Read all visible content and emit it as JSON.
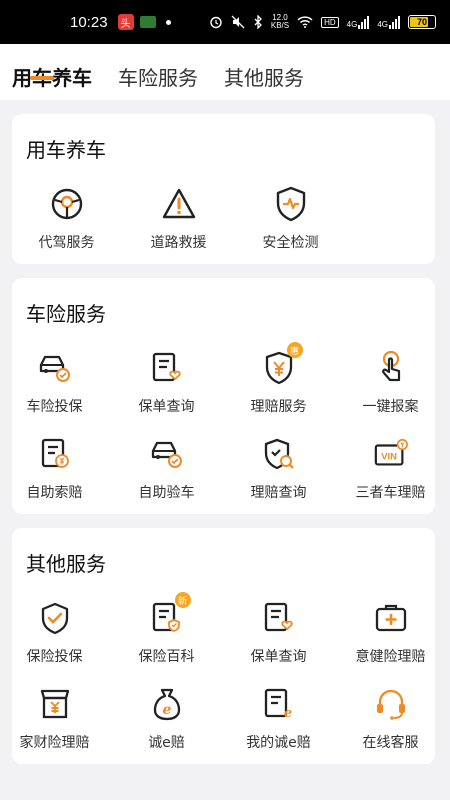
{
  "status_bar": {
    "time": "10:23",
    "app_badge": "头",
    "net_speed_value": "12.0",
    "net_speed_unit": "KB/S",
    "hd": "HD",
    "signal1": "4G",
    "signal2": "4G",
    "battery": "70"
  },
  "tabs": [
    {
      "label": "用车养车",
      "active": true
    },
    {
      "label": "车险服务",
      "active": false
    },
    {
      "label": "其他服务",
      "active": false
    }
  ],
  "sections": {
    "car_care": {
      "title": "用车养车",
      "items": [
        {
          "label": "代驾服务",
          "icon": "steering-wheel-icon"
        },
        {
          "label": "道路救援",
          "icon": "warning-triangle-icon"
        },
        {
          "label": "安全检测",
          "icon": "shield-pulse-icon"
        }
      ]
    },
    "insurance": {
      "title": "车险服务",
      "items": [
        {
          "label": "车险投保",
          "icon": "car-check-icon"
        },
        {
          "label": "保单查询",
          "icon": "doc-heart-icon"
        },
        {
          "label": "理赔服务",
          "icon": "shield-yen-icon",
          "badge": "惠"
        },
        {
          "label": "一键报案",
          "icon": "tap-hand-icon"
        },
        {
          "label": "自助索赔",
          "icon": "doc-yen-icon"
        },
        {
          "label": "自助验车",
          "icon": "car-check-icon"
        },
        {
          "label": "理赔查询",
          "icon": "shield-search-icon"
        },
        {
          "label": "三者车理赔",
          "icon": "vin-card-icon",
          "vin": "VIN"
        }
      ]
    },
    "other": {
      "title": "其他服务",
      "items": [
        {
          "label": "保险投保",
          "icon": "shield-check-icon"
        },
        {
          "label": "保险百科",
          "icon": "doc-shield-icon",
          "badge": "新"
        },
        {
          "label": "保单查询",
          "icon": "doc-heart-icon"
        },
        {
          "label": "意健险理赔",
          "icon": "medkit-icon"
        },
        {
          "label": "家财险理赔",
          "icon": "shop-yen-icon"
        },
        {
          "label": "诚e赔",
          "icon": "money-bag-e-icon"
        },
        {
          "label": "我的诚e赔",
          "icon": "doc-e-icon"
        },
        {
          "label": "在线客服",
          "icon": "headset-icon"
        }
      ]
    }
  },
  "colors": {
    "accent": "#f08a24",
    "icon_stroke": "#222222"
  }
}
